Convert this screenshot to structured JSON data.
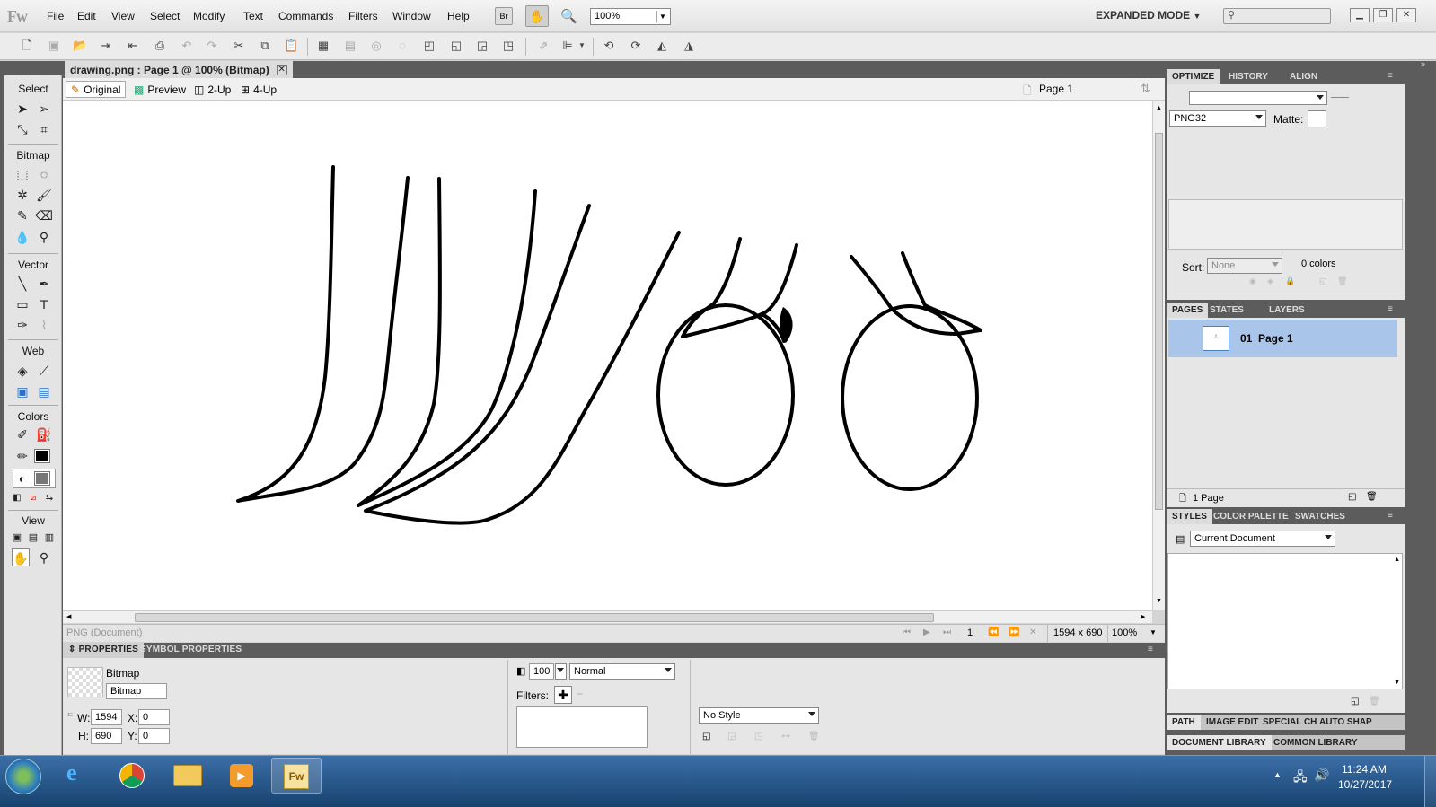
{
  "app": {
    "logo": "Fw",
    "mode_label": "EXPANDED MODE",
    "zoom_value": "100%"
  },
  "menu": [
    "File",
    "Edit",
    "View",
    "Select",
    "Modify",
    "Text",
    "Commands",
    "Filters",
    "Window",
    "Help"
  ],
  "document": {
    "tab_title": "drawing.png : Page 1 @ 100% (Bitmap)",
    "view_buttons": [
      "Original",
      "Preview",
      "2-Up",
      "4-Up"
    ],
    "page_select": "Page 1",
    "status_left": "PNG (Document)",
    "page_number": "1",
    "dimensions": "1594 x 690",
    "zoom": "100%"
  },
  "tools": {
    "sections": [
      "Select",
      "Bitmap",
      "Vector",
      "Web",
      "Colors",
      "View"
    ]
  },
  "properties": {
    "tabs": [
      "PROPERTIES",
      "SYMBOL PROPERTIES"
    ],
    "object_type": "Bitmap",
    "object_name": "Bitmap",
    "w_label": "W:",
    "w_value": "1594",
    "h_label": "H:",
    "h_value": "690",
    "x_label": "X:",
    "x_value": "0",
    "y_label": "Y:",
    "y_value": "0",
    "opacity": "100",
    "blend_mode": "Normal",
    "filters_label": "Filters:",
    "style": "No Style"
  },
  "optimize": {
    "tabs": [
      "OPTIMIZE",
      "HISTORY",
      "ALIGN"
    ],
    "format": "PNG32",
    "matte_label": "Matte:",
    "sort_label": "Sort:",
    "sort_value": "None",
    "colors_count": "0 colors"
  },
  "pages": {
    "tabs": [
      "PAGES",
      "STATES",
      "LAYERS"
    ],
    "items": [
      {
        "number": "01",
        "name": "Page 1"
      }
    ],
    "count": "1 Page"
  },
  "styles": {
    "tabs": [
      "STYLES",
      "COLOR PALETTE",
      "SWATCHES"
    ],
    "source": "Current Document"
  },
  "bottom_tabs1": [
    "PATH",
    "IMAGE EDIT",
    "SPECIAL CH",
    "AUTO SHAP"
  ],
  "bottom_tabs2": [
    "DOCUMENT LIBRARY",
    "COMMON LIBRARY"
  ],
  "taskbar": {
    "time": "11:24 AM",
    "date": "10/27/2017",
    "active_app_label": "Fw"
  }
}
